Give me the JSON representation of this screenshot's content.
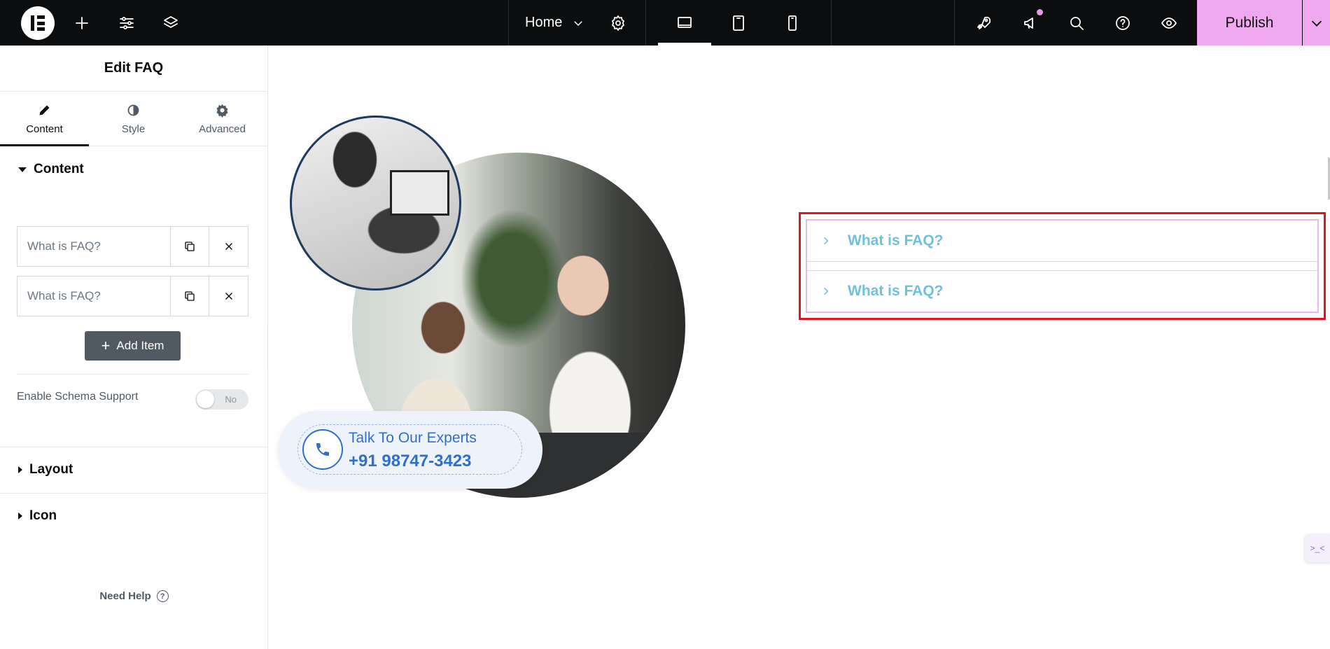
{
  "topbar": {
    "page_name": "Home",
    "publish_label": "Publish"
  },
  "panel": {
    "title": "Edit FAQ",
    "tabs": [
      {
        "label": "Content",
        "icon": "pencil-icon",
        "active": true
      },
      {
        "label": "Style",
        "icon": "half-circle-icon",
        "active": false
      },
      {
        "label": "Advanced",
        "icon": "gear-icon",
        "active": false
      }
    ],
    "content_section": "Content",
    "items": [
      {
        "title": "What is FAQ?"
      },
      {
        "title": "What is FAQ?"
      }
    ],
    "add_item_label": "Add Item",
    "schema_label": "Enable Schema Support",
    "schema_toggle": "No",
    "layout_section": "Layout",
    "icon_section": "Icon",
    "need_help": "Need Help"
  },
  "canvas": {
    "cta": {
      "line1": "Talk To Our Experts",
      "line2": "+91 98747-3423"
    },
    "faq": [
      {
        "question": "What is FAQ?"
      },
      {
        "question": "What is FAQ?"
      }
    ],
    "side_widget": ">_<"
  },
  "colors": {
    "topbar": "#0c0d0e",
    "publish": "#f0a9f0",
    "accent_blue": "#2f6fcc",
    "faq_text": "#6ec2d9",
    "highlight": "#e0141e"
  }
}
